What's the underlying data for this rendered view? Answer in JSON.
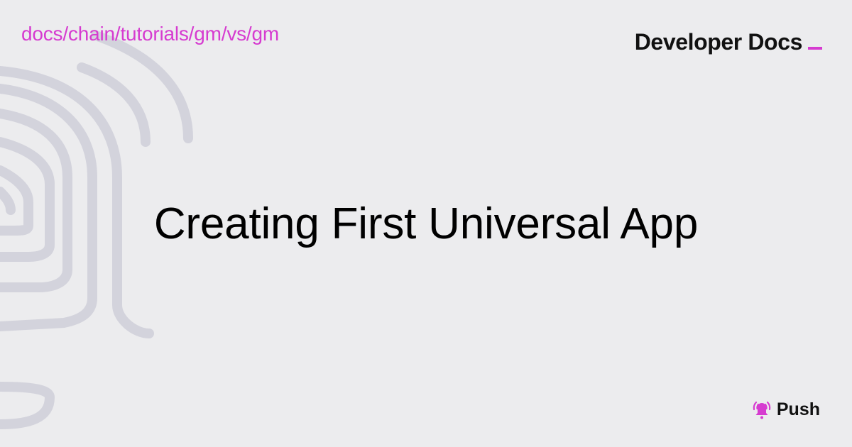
{
  "breadcrumb": {
    "path": "docs/chain/tutorials/gm/vs/gm"
  },
  "brand": {
    "label": "Developer Docs"
  },
  "main": {
    "title": "Creating First Universal App"
  },
  "footer": {
    "logo_label": "Push",
    "logo_icon": "bell-icon"
  },
  "background": {
    "decoration": "bell-line-art"
  },
  "colors": {
    "background": "#ececee",
    "accent": "#d63bd0",
    "line_art": "#d3d3dc",
    "text": "#000000"
  }
}
